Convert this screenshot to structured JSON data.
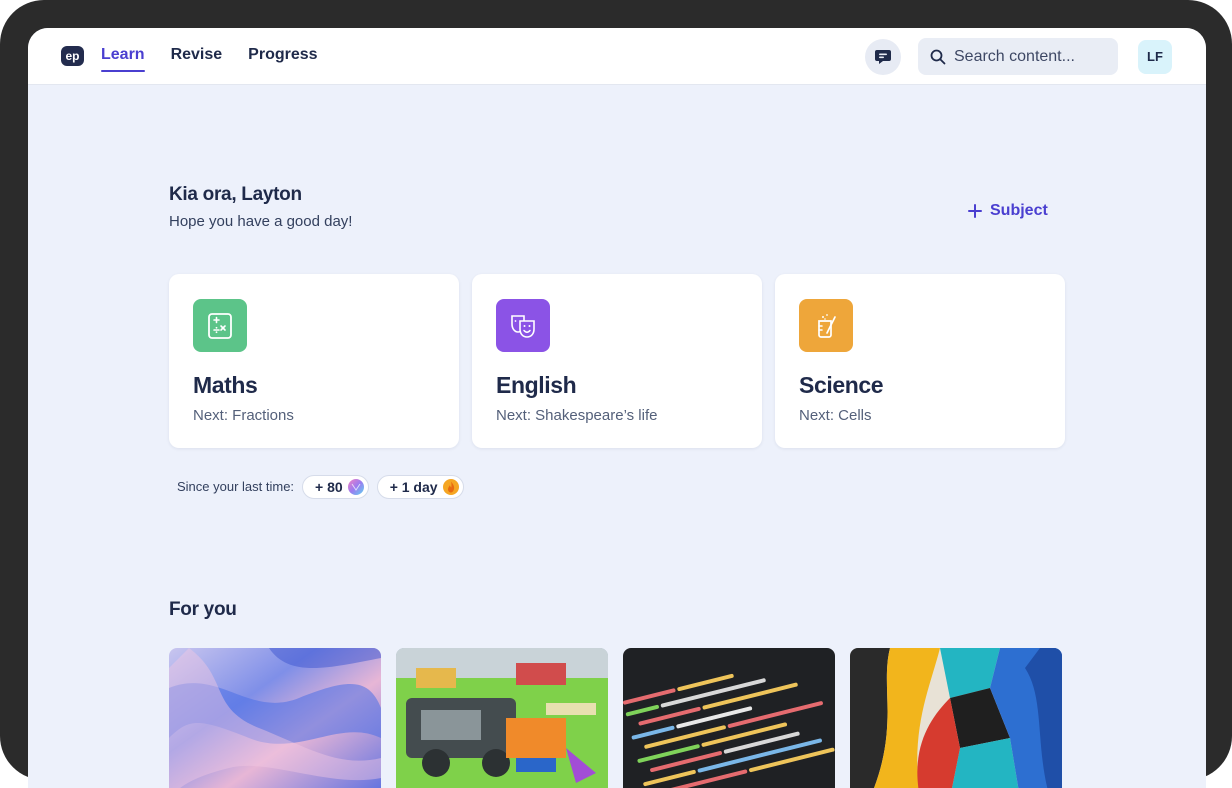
{
  "nav": {
    "logo": "ep",
    "items": [
      {
        "label": "Learn",
        "active": true
      },
      {
        "label": "Revise",
        "active": false
      },
      {
        "label": "Progress",
        "active": false
      }
    ]
  },
  "header": {
    "chat_icon": "chat-bubble-icon",
    "search_placeholder": "Search content...",
    "avatar_initials": "LF"
  },
  "greeting": {
    "title": "Kia ora, Layton",
    "subtitle": "Hope you have a good day!"
  },
  "add_subject_label": "Subject",
  "subjects": [
    {
      "name": "Maths",
      "next": "Next: Fractions",
      "color": "#5cc489",
      "icon": "maths-icon"
    },
    {
      "name": "English",
      "next": "Next: Shakespeare’s life",
      "color": "#8b53e6",
      "icon": "theatre-masks-icon"
    },
    {
      "name": "Science",
      "next": "Next: Cells",
      "color": "#eea63a",
      "icon": "beaker-icon"
    }
  ],
  "since": {
    "label": "Since your last time:",
    "points": "+ 80",
    "streak": "+ 1 day"
  },
  "for_you": {
    "title": "For you"
  },
  "colors": {
    "accent": "#4a3fd0",
    "background": "#edf1fb",
    "text": "#1f2a4a"
  }
}
